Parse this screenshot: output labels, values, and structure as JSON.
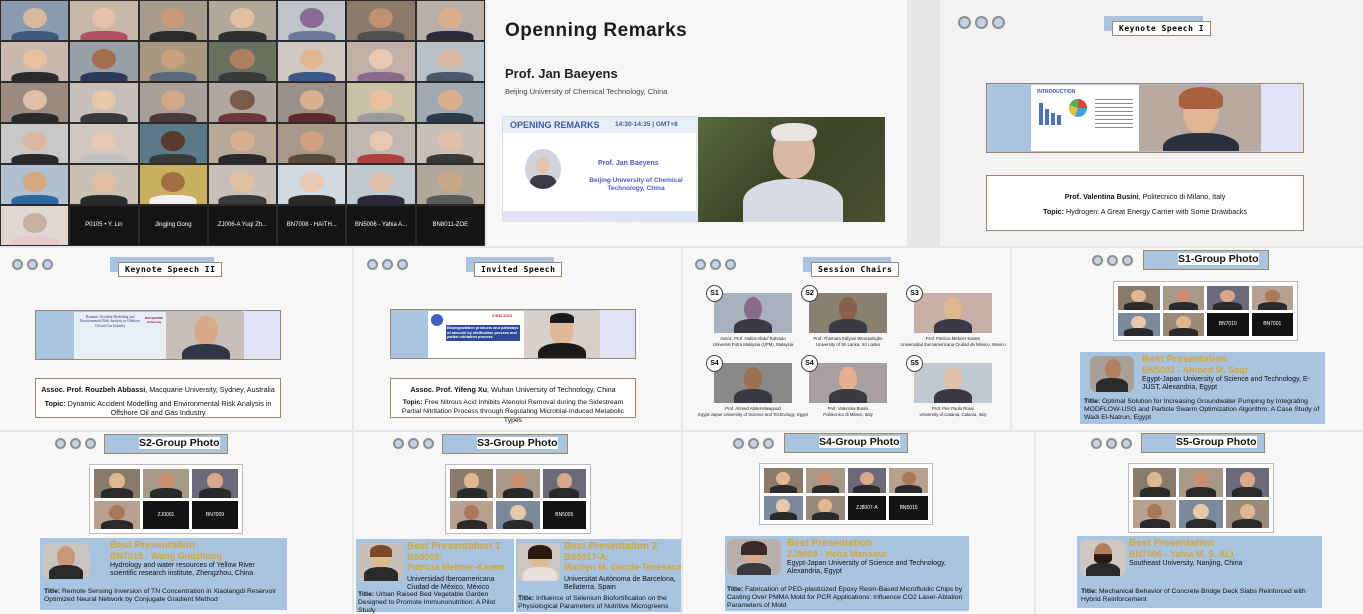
{
  "gallery": {
    "tiles": [
      {
        "name": "",
        "dark": false,
        "bg": "#8a9bb0",
        "skin": "#d9b8a0",
        "shirt": "#405a7a"
      },
      {
        "name": "",
        "dark": false,
        "bg": "#c8b8a8",
        "skin": "#e8c0a8",
        "shirt": "#b05060"
      },
      {
        "name": "",
        "dark": false,
        "bg": "#a89c8c",
        "skin": "#c89878",
        "shirt": "#2a2a2a"
      },
      {
        "name": "",
        "dark": false,
        "bg": "#b0a898",
        "skin": "#e0c0a0",
        "shirt": "#303030"
      },
      {
        "name": "",
        "dark": false,
        "bg": "#c0c4c8",
        "skin": "#8a6a98",
        "shirt": "#6a7a9a"
      },
      {
        "name": "",
        "dark": false,
        "bg": "#8a7a6a",
        "skin": "#c09070",
        "shirt": "#505050"
      },
      {
        "name": "",
        "dark": false,
        "bg": "#b8b0a8",
        "skin": "#d8b090",
        "shirt": "#2a2a3a"
      },
      {
        "name": "",
        "dark": false,
        "bg": "#c8b8b0",
        "skin": "#e8c0a0",
        "shirt": "#2a2a2a"
      },
      {
        "name": "",
        "dark": false,
        "bg": "#9aa0a8",
        "skin": "#a07050",
        "shirt": "#2a3a5a"
      },
      {
        "name": "",
        "dark": false,
        "bg": "#a89880",
        "skin": "#c8a080",
        "shirt": "#5a6a7a"
      },
      {
        "name": "",
        "dark": false,
        "bg": "#6a7060",
        "skin": "#b08060",
        "shirt": "#3a3a3a"
      },
      {
        "name": "",
        "dark": false,
        "bg": "#d0c8c0",
        "skin": "#e0b890",
        "shirt": "#3a5a8a"
      },
      {
        "name": "",
        "dark": false,
        "bg": "#c0b0a8",
        "skin": "#e8c8b0",
        "shirt": "#8a6a8a"
      },
      {
        "name": "",
        "dark": false,
        "bg": "#b8c0c8",
        "skin": "#d8b8a0",
        "shirt": "#4a5a6a"
      },
      {
        "name": "",
        "dark": false,
        "bg": "#9a8a80",
        "skin": "#e0c0a8",
        "shirt": "#2a2a2a"
      },
      {
        "name": "",
        "dark": false,
        "bg": "#c8c0b8",
        "skin": "#e8c8a8",
        "shirt": "#3a3a3a"
      },
      {
        "name": "",
        "dark": false,
        "bg": "#a8a098",
        "skin": "#d0a888",
        "shirt": "#4a3a3a"
      },
      {
        "name": "",
        "dark": false,
        "bg": "#b0a8a0",
        "skin": "#7a5a48",
        "shirt": "#6a3a3a"
      },
      {
        "name": "",
        "dark": false,
        "bg": "#9a9088",
        "skin": "#d8b090",
        "shirt": "#5a2a2a"
      },
      {
        "name": "",
        "dark": false,
        "bg": "#c8c0a8",
        "skin": "#e8c0a0",
        "shirt": "#9a9a9a"
      },
      {
        "name": "",
        "dark": false,
        "bg": "#a0a8b0",
        "skin": "#d8b090",
        "shirt": "#2a3a4a"
      },
      {
        "name": "",
        "dark": false,
        "bg": "#c8c8c8",
        "skin": "#d8b8a0",
        "shirt": "#2a2a2a"
      },
      {
        "name": "",
        "dark": false,
        "bg": "#d0c8c0",
        "skin": "#e8c8b0",
        "shirt": "#c0c0c0"
      },
      {
        "name": "",
        "dark": false,
        "bg": "#5a7a8a",
        "skin": "#5a3a2a",
        "shirt": "#3a3a3a"
      },
      {
        "name": "",
        "dark": false,
        "bg": "#b8a898",
        "skin": "#d8b090",
        "shirt": "#2a2a2a"
      },
      {
        "name": "",
        "dark": false,
        "bg": "#a89888",
        "skin": "#d0a080",
        "shirt": "#5a4a3a"
      },
      {
        "name": "",
        "dark": false,
        "bg": "#c0b8b0",
        "skin": "#e8c8b0",
        "shirt": "#b04040"
      },
      {
        "name": "",
        "dark": false,
        "bg": "#c8c0b8",
        "skin": "#e0c0a8",
        "shirt": "#3a3a3a"
      },
      {
        "name": "",
        "dark": false,
        "bg": "#b0c0d0",
        "skin": "#d8a880",
        "shirt": "#2a6aa0"
      },
      {
        "name": "",
        "dark": false,
        "bg": "#c8c0b0",
        "skin": "#e0c0a0",
        "shirt": "#2a2a2a"
      },
      {
        "name": "",
        "dark": false,
        "bg": "#c8b060",
        "skin": "#a07040",
        "shirt": "#f0f0f0"
      },
      {
        "name": "",
        "dark": false,
        "bg": "#c8c0b8",
        "skin": "#e0c0a0",
        "shirt": "#3a3a3a"
      },
      {
        "name": "",
        "dark": false,
        "bg": "#d0d8e0",
        "skin": "#e8c8b0",
        "shirt": "#2a2a2a"
      },
      {
        "name": "",
        "dark": false,
        "bg": "#c0c8d0",
        "skin": "#e0c0a8",
        "shirt": "#2a2a3a"
      },
      {
        "name": "",
        "dark": false,
        "bg": "#b0a898",
        "skin": "#c8a888",
        "shirt": "#5a5a5a"
      },
      {
        "name": "",
        "dark": false,
        "bg": "#e0d8d0",
        "skin": "#c8b0a0",
        "shirt": "#e8c8c8"
      },
      {
        "name": "P0105 • Y. Lin",
        "dark": true
      },
      {
        "name": "Jingjing Gong",
        "dark": true
      },
      {
        "name": "ZJ006-A Yuqi Zh...",
        "dark": true
      },
      {
        "name": "BN7008 - HAITH...",
        "dark": true
      },
      {
        "name": "BN5006 - Yahia A...",
        "dark": true
      },
      {
        "name": "BN8011-ZOE",
        "dark": true
      }
    ]
  },
  "opening": {
    "title": "Openning Remarks",
    "speaker": "Prof. Jan Baeyens",
    "affiliation": "Beijing University of Chemical Technology, China",
    "slide_heading": "OPENING REMARKS",
    "slide_time": "14:30-14:35 | GMT+8",
    "slide_speaker": "Prof. Jan Baeyens",
    "slide_aff": "Beijing University of Chemical Technology, China"
  },
  "keynote1": {
    "label": "Keynote Speech I",
    "slide_heading": "INTRODUCTION",
    "speaker": "Prof. Valentina Busini",
    "speaker_aff": ", Politecnico di Milano, Italy",
    "topic_label": "Topic:",
    "topic": " Hydrogen: A Great Energy Carrier with Some Drawbacks"
  },
  "keynote2": {
    "label": "Keynote Speech II",
    "slide_text": "Dynamic Accident Modelling and Environmental Risk Analysis in Offshore Oil and Gas Industry",
    "logo": "MACQUARIE University",
    "speaker": "Assoc. Prof. Rouzbeh Abbassi",
    "speaker_aff": ", Macquarie University, Sydney, Australia",
    "topic_label": "Topic:",
    "topic": " Dynamic Accident Modelling and Environmental Risk Analysis in Offshore Oil and Gas Industry"
  },
  "invited": {
    "label": "Invited Speech",
    "slide_badge": "ICEM 2023",
    "slide_text": "Biodegradation products and pathways of atenolol by nitrification process and partial nitritation process",
    "speaker": "Assoc. Prof. Yifeng Xu",
    "speaker_aff": ", Wuhan University of Technology, China",
    "topic_label": "Topic:",
    "topic": " Free Nitrous Acid Inhibits Atenolol Removal during the Sidestream Partial Nitritation Process through Regulating Microbial-Induced Metabolic Types"
  },
  "chairs": {
    "label": "Session Chairs",
    "items": [
      {
        "badge": "S1",
        "cap": "Assoc. Prof. Haliza Abdul Rahman\nUniversiti Putra Malaysia (UPM), Malaysia",
        "bg": "#a8b0c0",
        "skin": "#8a6a8a"
      },
      {
        "badge": "S2",
        "cap": "Prof. Thamara Kalyani Weerasinghe\nUniversity of Sri Lanka, Sri Lanka",
        "bg": "#8a8070",
        "skin": "#8a6048"
      },
      {
        "badge": "S3",
        "cap": "Prof. Patricia Mehner Karam\nUniversidad Iberoamericana Ciudad de México, Mexico",
        "bg": "#c8b0a8",
        "skin": "#e0b890"
      },
      {
        "badge": "S4",
        "cap": "Prof. Ahmed Abdel-Mawgood\nEgypt-Japan University of Science and Technology, Egypt",
        "bg": "#8a8888",
        "skin": "#9a7050"
      },
      {
        "badge": "S4",
        "cap": "Prof. Valentina Busini\nPolitecnico di Milano, Italy",
        "bg": "#a8a0a0",
        "skin": "#e8b090"
      },
      {
        "badge": "S5",
        "cap": "Prof. Pier Paolo Rossi\nUniversity of Catania, Catania, Italy",
        "bg": "#c0c8d0",
        "skin": "#e0c0a8"
      }
    ]
  },
  "s1": {
    "title": "S1-Group Photo",
    "cells": [
      "",
      "",
      "",
      "",
      "",
      "",
      "BN7010",
      "BN7001"
    ],
    "bp_title": "Best Presentation",
    "bp_name": "BN5002 - Ahmed M. Saqr",
    "bp_aff": "Egypt-Japan University of Science and Technology, E-JUST, Alexandria, Egypt",
    "bp_topic_label": "Title:",
    "bp_topic": " Optimal Solution for Increasing Groundwater Pumping by Integrating MODFLOW-USG and Particle Swarm Optimization Algorithm: A Case Study of Wadi El-Natrun, Egypt"
  },
  "s2": {
    "title": "S2-Group Photo",
    "cells": [
      "",
      "",
      "",
      "",
      "ZJ0001",
      "BN7009"
    ],
    "bp_title": "Best Presentation",
    "bp_name": "BN7015 - Wang Guozhong",
    "bp_aff": "Hydrology and water resources of Yellow River scientific research institute, Zhengzhou, China",
    "bp_topic_label": "Title:",
    "bp_topic": " Remote Sensing Inversion of TN Concentration in Xiaolangdi Reservoir Optimized Neural Network by Conjugate Gradient Method"
  },
  "s3": {
    "title": "S3-Group Photo",
    "cells": [
      "",
      "",
      "",
      "",
      "",
      "BN5005"
    ],
    "bp1_title": "Best Presentation 1",
    "bp1_name": "BS5005:\nPatricia Mehner-Karam",
    "bp1_aff": "Universidad Iberoamericana Ciudad de México, México",
    "bp1_topic_label": "Title:",
    "bp1_topic": " Urban Raised Bed Vegetable Garden Designed to Promote Immunonutrition: A Pilot Study",
    "bp2_title": "Best Presentation 2",
    "bp2_name": "BS5017-A:\nMarilyn M. García-Tenesaca",
    "bp2_aff": "Universitat Autònoma de Barcelona, Bellaterra, Spain",
    "bp2_topic_label": "Title:",
    "bp2_topic": " Influence of Selenium Biofortification on the Physiological Parameters of Nutritive Microgreens"
  },
  "s4": {
    "title": "S4-Group Photo",
    "cells": [
      "",
      "",
      "",
      "",
      "",
      "",
      "ZJ8007-A",
      "BN5015"
    ],
    "bp_title": "Best Presentation",
    "bp_name": "ZJ8009 - Heba Mansour",
    "bp_aff": "Egypt-Japan University of Science and Technology, Alexandria, Egypt",
    "bp_topic_label": "Title:",
    "bp_topic": " Fabrication of PEG-plasticized Epoxy Resin-Based Microfluidic Chips by Casting Over PMMA Mold for PCR Applications: Influence CO2 Laser-Ablation Parameters of Mold"
  },
  "s5": {
    "title": "S5-Group Photo",
    "cells": [
      "",
      "",
      "",
      "",
      "",
      ""
    ],
    "bp_title": "Best Presentation",
    "bp_name": "BN7006 - Yahia M. S. ALi",
    "bp_aff": "Southeast University, Nanjing, China",
    "bp_topic_label": "Title:",
    "bp_topic": " Mechanical Behavior of Concrete Bridge Deck Slabs Reinforced with Hybrid Reinforcement"
  },
  "colors": {
    "accent": "#a9c4e0",
    "gold": "#d8a637",
    "border": "#9a8a6a"
  }
}
